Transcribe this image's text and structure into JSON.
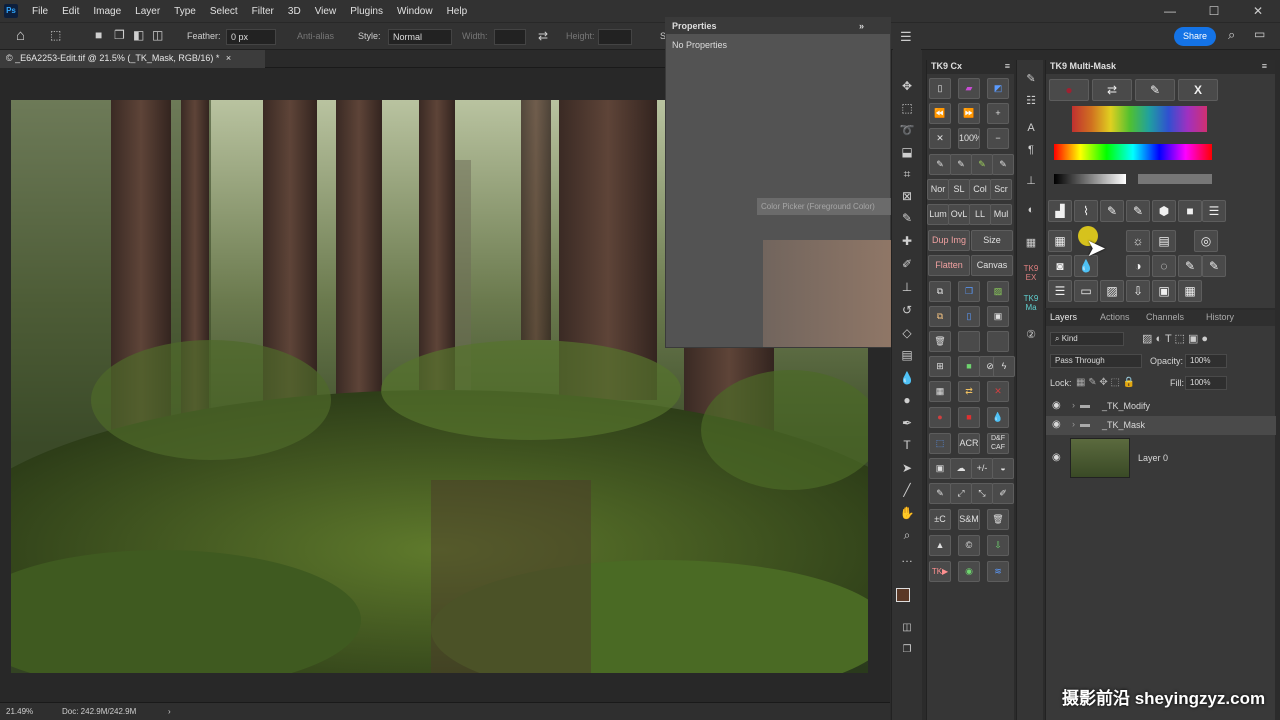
{
  "menu": [
    "File",
    "Edit",
    "Image",
    "Layer",
    "Type",
    "Select",
    "Filter",
    "3D",
    "View",
    "Plugins",
    "Window",
    "Help"
  ],
  "logo": "Ps",
  "window_controls": {
    "minimize": "—",
    "maximize": "☐",
    "close": "✕"
  },
  "options": {
    "feather_label": "Feather:",
    "feather_value": "0 px",
    "antialias_label": "Anti-alias",
    "style_label": "Style:",
    "style_value": "Normal",
    "width_label": "Width:",
    "height_label": "Height:",
    "s_label": "S",
    "share_label": "Share"
  },
  "document": {
    "tab_title": "© _E6A2253-Edit.tif @ 21.5% (_TK_Mask, RGB/16) *",
    "close": "×"
  },
  "status": {
    "zoom": "21.49%",
    "doc": "Doc: 242.9M/242.9M",
    "arrow": "›"
  },
  "properties": {
    "title": "Properties",
    "body": "No Properties",
    "collapse": "»"
  },
  "tooltip": {
    "text": "Color Picker (Foreground Color)"
  },
  "tools_icons": [
    "move-icon",
    "marquee-icon",
    "lasso-icon",
    "object-select-icon",
    "crop-icon",
    "frame-icon",
    "eyedropper-icon",
    "healing-icon",
    "brush-icon",
    "stamp-icon",
    "history-brush-icon",
    "eraser-icon",
    "gradient-icon",
    "blur-icon",
    "dodge-icon",
    "pen-icon",
    "type-icon",
    "path-select-icon",
    "line-icon",
    "hand-icon",
    "zoom-icon",
    "more-icon"
  ],
  "tk9cx": {
    "title": "TK9 Cx",
    "row_labels": [
      "Nor",
      "SL",
      "Col",
      "Scr",
      "Lum",
      "OvL",
      "LL",
      "Mul"
    ],
    "dup_img": "Dup Img",
    "size": "Size",
    "flatten": "Flatten",
    "canvas": "Canvas",
    "zoom_label": "100%",
    "acr": "ACR",
    "df_top": "D&F",
    "df_bottom": "CAF",
    "plus_minus": "+/-",
    "sm": "S&M",
    "pm": "±C",
    "tk": "TK▶",
    "copyright": "©"
  },
  "stripe2": {
    "tk9_a": "TK9",
    "tk9_b": "EX",
    "tk9_c": "TK9",
    "tk9_d": "Ma"
  },
  "multimask": {
    "title": "TK9 Multi-Mask",
    "x_button": "X"
  },
  "layers": {
    "tabs": [
      "Layers",
      "Actions",
      "Channels",
      "History"
    ],
    "kind": "Kind",
    "blend": "Pass Through",
    "opacity_label": "Opacity:",
    "opacity": "100%",
    "lock_label": "Lock:",
    "fill_label": "Fill:",
    "fill": "100%",
    "rows": [
      "_TK_Modify",
      "_TK_Mask",
      "Layer 0"
    ]
  },
  "watermark": "摄影前沿 sheyingzyz.com",
  "colors": {
    "accent": "#1473e6",
    "foreground": "#5a3826",
    "background": "#111111"
  }
}
